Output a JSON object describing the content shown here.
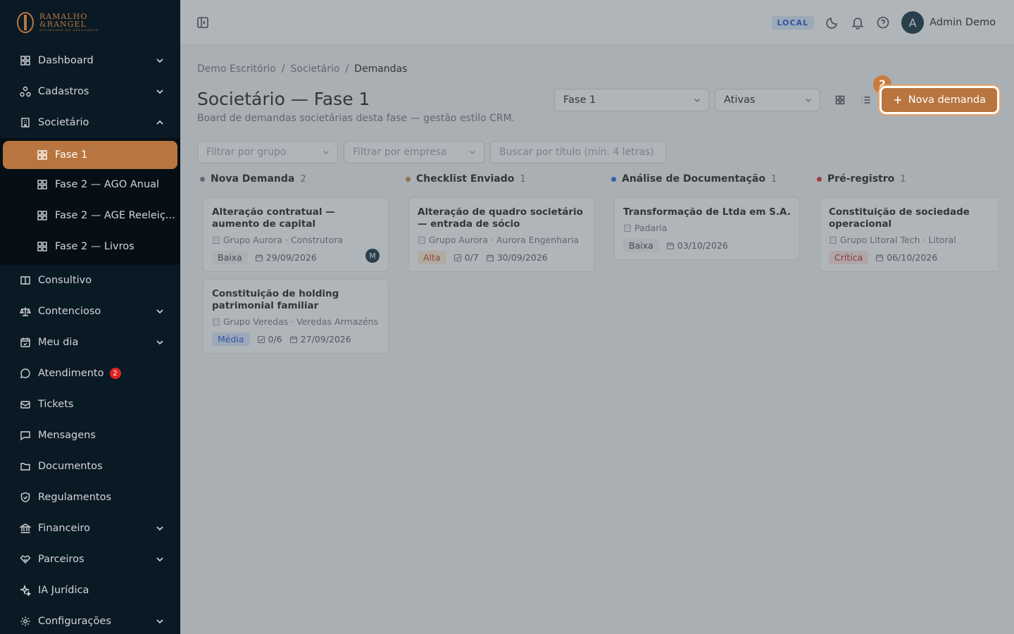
{
  "brand": {
    "line1": "RAMALHO",
    "line2": "&RANGEL",
    "tagline": "SOCIEDADE DE ADVOGADOS"
  },
  "sidebar": {
    "items": [
      {
        "label": "Dashboard",
        "icon": "grid-icon",
        "chevron": "down"
      },
      {
        "label": "Cadastros",
        "icon": "network-icon",
        "chevron": "down"
      },
      {
        "label": "Societário",
        "icon": "building-icon",
        "chevron": "up"
      },
      {
        "label": "Consultivo",
        "icon": "book-icon"
      },
      {
        "label": "Contencioso",
        "icon": "scale-icon",
        "chevron": "down"
      },
      {
        "label": "Meu dia",
        "icon": "calendar-icon",
        "chevron": "down"
      },
      {
        "label": "Atendimento",
        "icon": "chat-icon",
        "badge": "2"
      },
      {
        "label": "Tickets",
        "icon": "ticket-icon"
      },
      {
        "label": "Mensagens",
        "icon": "message-icon"
      },
      {
        "label": "Documentos",
        "icon": "folder-icon"
      },
      {
        "label": "Regulamentos",
        "icon": "shield-icon"
      },
      {
        "label": "Financeiro",
        "icon": "bank-icon",
        "chevron": "down"
      },
      {
        "label": "Parceiros",
        "icon": "handshake-icon",
        "chevron": "down"
      },
      {
        "label": "IA Jurídica",
        "icon": "sparkle-icon"
      },
      {
        "label": "Configurações",
        "icon": "gear-icon",
        "chevron": "down"
      }
    ],
    "sub_items": [
      {
        "label": "Fase 1",
        "active": true
      },
      {
        "label": "Fase 2 — AGO Anual"
      },
      {
        "label": "Fase 2 — AGE Reeleiç..."
      },
      {
        "label": "Fase 2 — Livros"
      }
    ]
  },
  "header": {
    "env": "LOCAL",
    "avatar_initial": "A",
    "user": "Admin Demo"
  },
  "breadcrumb": [
    "Demo Escritório",
    "Societário",
    "Demandas"
  ],
  "page": {
    "title": "Societário — Fase 1",
    "subtitle": "Board de demandas societárias desta fase — gestão estilo CRM.",
    "phase_select": "Fase 1",
    "status_select": "Ativas",
    "new_button": "Nova demanda",
    "step_badge": "2"
  },
  "filters": {
    "group_placeholder": "Filtrar por grupo",
    "company_placeholder": "Filtrar por empresa",
    "search_placeholder": "Buscar por título (mín. 4 letras)"
  },
  "columns": [
    {
      "name": "Nova Demanda",
      "count": "2",
      "color": "#71717a",
      "cards": [
        {
          "title": "Alteração contratual — aumento de capital",
          "company": "Grupo Aurora · Construtora",
          "priority": "Baixa",
          "prio_class": "low",
          "checklist": "",
          "date": "29/09/2026",
          "assignee": "M"
        },
        {
          "title": "Constituição de holding patrimonial familiar",
          "company": "Grupo Veredas · Veredas Armazéns",
          "priority": "Média",
          "prio_class": "medium",
          "checklist": "0/6",
          "date": "27/09/2026",
          "assignee": ""
        }
      ]
    },
    {
      "name": "Checklist Enviado",
      "count": "1",
      "color": "#c97c3d",
      "cards": [
        {
          "title": "Alteração de quadro societário — entrada de sócio",
          "company": "Grupo Aurora · Aurora Engenharia",
          "priority": "Alta",
          "prio_class": "high",
          "checklist": "0/7",
          "date": "30/09/2026",
          "assignee": ""
        }
      ]
    },
    {
      "name": "Análise de Documentação",
      "count": "1",
      "color": "#2563eb",
      "cards": [
        {
          "title": "Transformação de Ltda em S.A.",
          "company": "Padaria",
          "priority": "Baixa",
          "prio_class": "low",
          "checklist": "",
          "date": "03/10/2026",
          "assignee": ""
        }
      ]
    },
    {
      "name": "Pré-registro",
      "count": "1",
      "color": "#dc2626",
      "cards": [
        {
          "title": "Constituição de sociedade operacional",
          "company": "Grupo Litoral Tech · Litoral",
          "priority": "Crítica",
          "prio_class": "crit",
          "checklist": "",
          "date": "06/10/2026",
          "assignee": ""
        }
      ]
    }
  ]
}
